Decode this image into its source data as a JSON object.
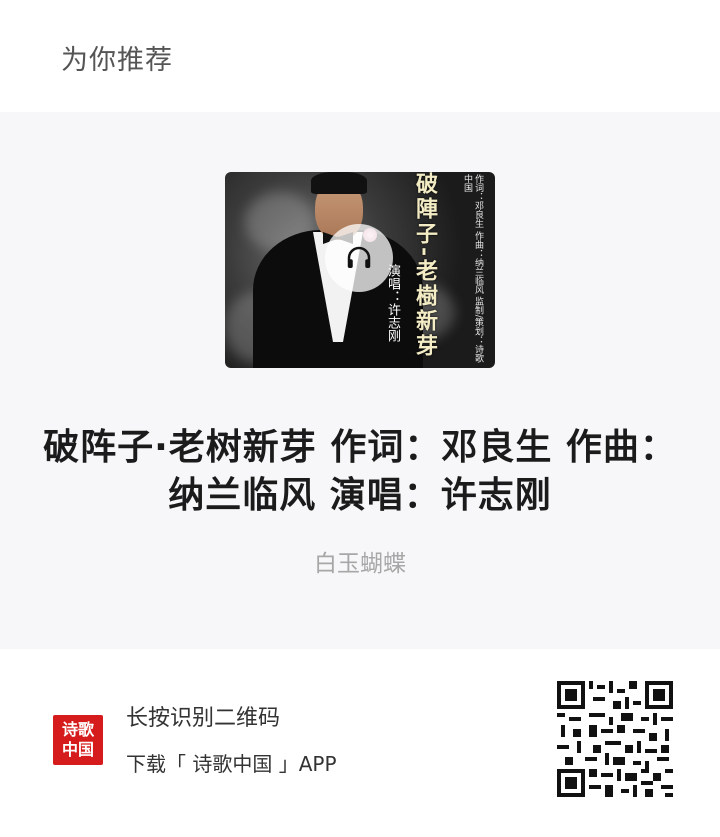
{
  "header": {
    "title": "为你推荐"
  },
  "card": {
    "cover": {
      "title_vertical": "破陣子-老樹新芽",
      "credits_vertical": "作词：邓良生 作曲：纳兰临风 监制/策划：诗歌中国",
      "singer_vertical": "演唱：许志刚",
      "play_icon": "headphones-icon"
    },
    "title": "破阵子·老树新芽 作词：邓良生 作曲：纳兰临风 演唱：许志刚",
    "author": "白玉蝴蝶"
  },
  "footer": {
    "logo_text": "诗歌中国",
    "line1": "长按识别二维码",
    "line2": "下载「 诗歌中国 」APP",
    "qr_icon": "qr-code-icon"
  },
  "colors": {
    "logo_red": "#d51b1b",
    "card_bg": "#f7f7f9",
    "author_gray": "#a7a7a7"
  }
}
